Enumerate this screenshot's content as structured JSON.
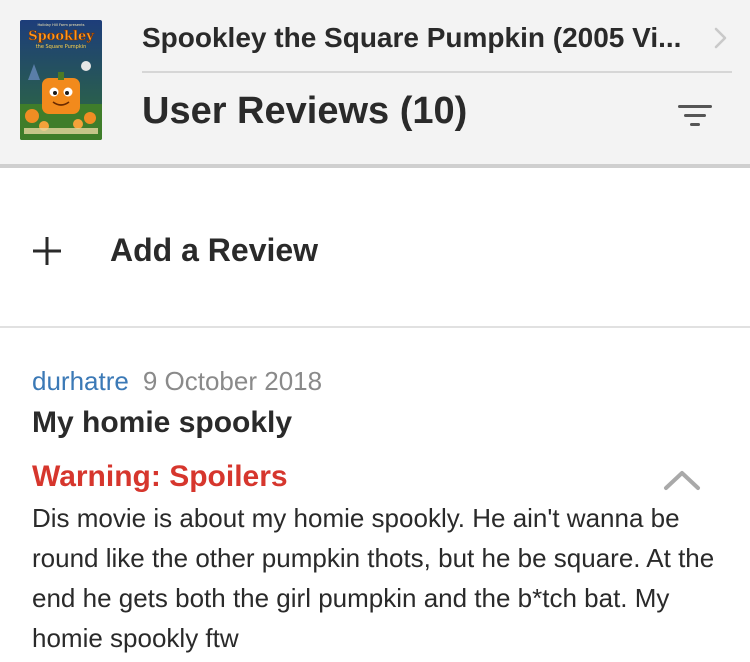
{
  "header": {
    "poster": {
      "top_text": "Holiday Hill Farm presents",
      "logo_line1": "Spookley",
      "logo_line2": "the Square Pumpkin"
    },
    "title": "Spookley the Square Pumpkin (2005 Vi...",
    "section_title": "User Reviews (10)"
  },
  "add_review": {
    "label": "Add a Review"
  },
  "review": {
    "author": "durhatre",
    "date": "9 October 2018",
    "title": "My homie spookly",
    "spoiler_warning": "Warning: Spoilers",
    "body": "Dis movie is about my homie spookly. He ain't wanna be round like the other pumpkin thots, but he be square. At the end he gets both the girl pumpkin and the b*tch bat. My homie spookly ftw"
  },
  "colors": {
    "author_link": "#3b79b6",
    "spoiler": "#d6362d",
    "header_bg": "#f3f3f3"
  },
  "icons": {
    "title_arrow": "chevron-right-icon",
    "filter": "filter-icon",
    "add": "plus-icon",
    "collapse": "chevron-up-icon"
  }
}
